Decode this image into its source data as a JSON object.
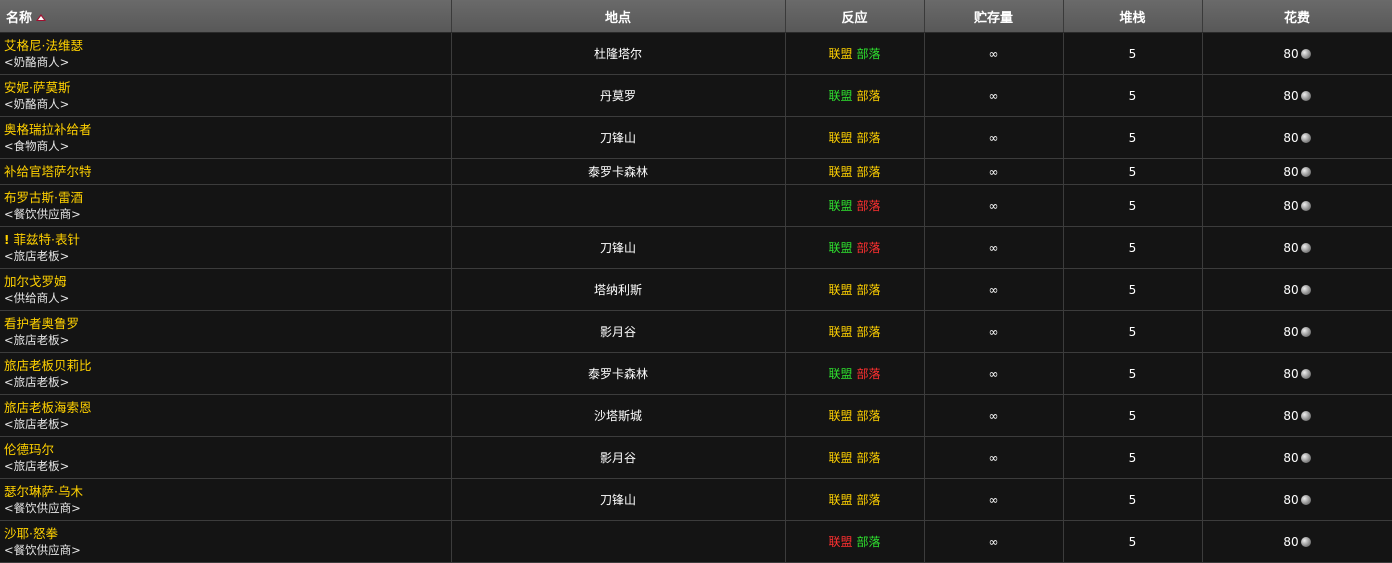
{
  "colors": {
    "yellow": "#ffd100",
    "green": "#2ee02e",
    "red": "#ff3030"
  },
  "headers": {
    "name": "名称",
    "location": "地点",
    "reaction": "反应",
    "stock": "贮存量",
    "stack": "堆栈",
    "cost": "花费"
  },
  "reaction_labels": {
    "alliance": "联盟",
    "horde": "部落"
  },
  "rows": [
    {
      "name": "艾格尼·法维瑟",
      "title": "<奶酪商人>",
      "location": "杜隆塔尔",
      "alliance": "yellow",
      "horde": "green",
      "stock": "∞",
      "stack": "5",
      "cost": "80"
    },
    {
      "name": "安妮·萨莫斯",
      "title": "<奶酪商人>",
      "location": "丹莫罗",
      "alliance": "green",
      "horde": "yellow",
      "stock": "∞",
      "stack": "5",
      "cost": "80"
    },
    {
      "name": "奥格瑞拉补给者",
      "title": "<食物商人>",
      "location": "刀锋山",
      "alliance": "yellow",
      "horde": "yellow",
      "stock": "∞",
      "stack": "5",
      "cost": "80"
    },
    {
      "name": "补给官塔萨尔特",
      "title": "",
      "location": "泰罗卡森林",
      "alliance": "yellow",
      "horde": "yellow",
      "stock": "∞",
      "stack": "5",
      "cost": "80"
    },
    {
      "name": "布罗古斯·雷酒",
      "title": "<餐饮供应商>",
      "location": "",
      "alliance": "green",
      "horde": "red",
      "stock": "∞",
      "stack": "5",
      "cost": "80"
    },
    {
      "name": "菲兹特·表针",
      "title": "<旅店老板>",
      "location": "刀锋山",
      "alliance": "green",
      "horde": "red",
      "stock": "∞",
      "stack": "5",
      "cost": "80",
      "quest": "!"
    },
    {
      "name": "加尔戈罗姆",
      "title": "<供给商人>",
      "location": "塔纳利斯",
      "alliance": "yellow",
      "horde": "yellow",
      "stock": "∞",
      "stack": "5",
      "cost": "80"
    },
    {
      "name": "看护者奥鲁罗",
      "title": "<旅店老板>",
      "location": "影月谷",
      "alliance": "yellow",
      "horde": "yellow",
      "stock": "∞",
      "stack": "5",
      "cost": "80"
    },
    {
      "name": "旅店老板贝莉比",
      "title": "<旅店老板>",
      "location": "泰罗卡森林",
      "alliance": "green",
      "horde": "red",
      "stock": "∞",
      "stack": "5",
      "cost": "80"
    },
    {
      "name": "旅店老板海索恩",
      "title": "<旅店老板>",
      "location": "沙塔斯城",
      "alliance": "yellow",
      "horde": "yellow",
      "stock": "∞",
      "stack": "5",
      "cost": "80"
    },
    {
      "name": "伦德玛尔",
      "title": "<旅店老板>",
      "location": "影月谷",
      "alliance": "yellow",
      "horde": "yellow",
      "stock": "∞",
      "stack": "5",
      "cost": "80"
    },
    {
      "name": "瑟尔琳萨·乌木",
      "title": "<餐饮供应商>",
      "location": "刀锋山",
      "alliance": "yellow",
      "horde": "yellow",
      "stock": "∞",
      "stack": "5",
      "cost": "80"
    },
    {
      "name": "沙耶·怒拳",
      "title": "<餐饮供应商>",
      "location": "",
      "alliance": "red",
      "horde": "green",
      "stock": "∞",
      "stack": "5",
      "cost": "80"
    }
  ]
}
